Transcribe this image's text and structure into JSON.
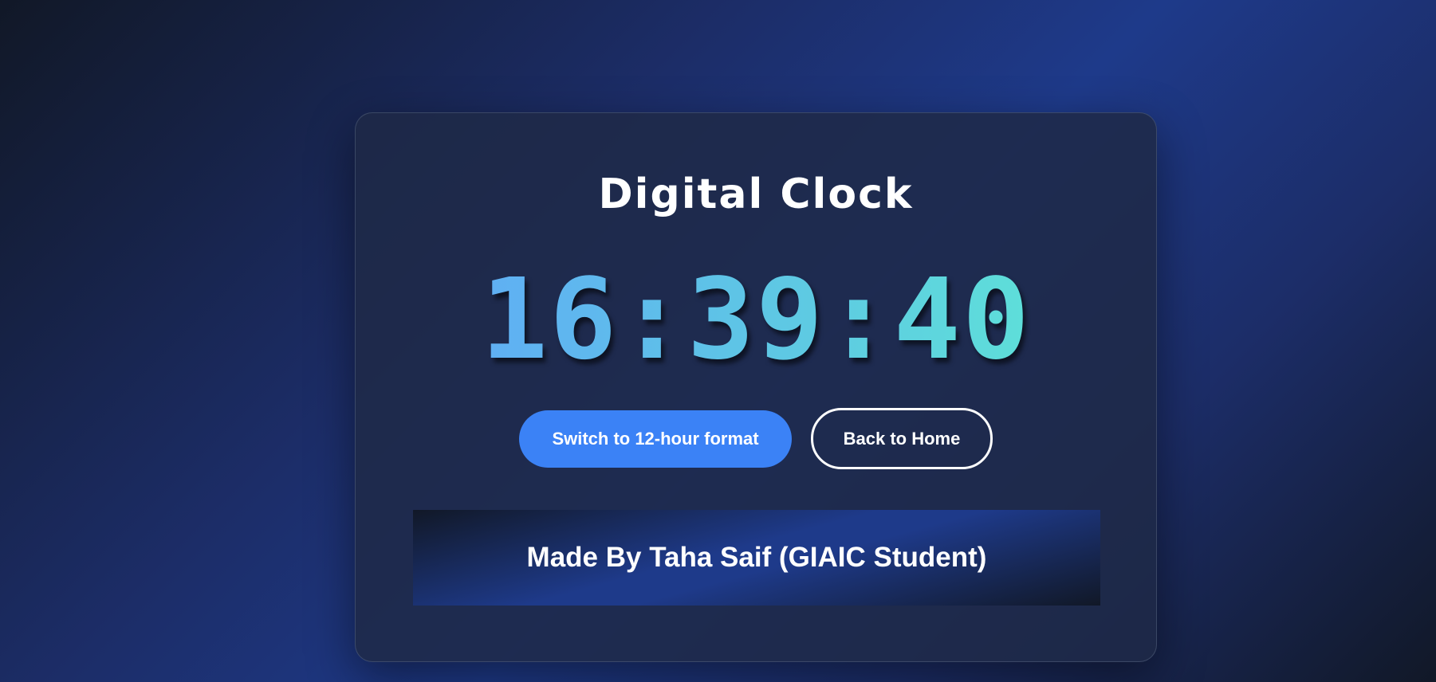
{
  "card": {
    "title": "Digital Clock",
    "time": "16:39:40",
    "buttons": {
      "format_toggle": "Switch to 12-hour format",
      "home": "Back to Home"
    },
    "footer": "Made By Taha Saif (GIAIC Student)"
  },
  "colors": {
    "background_dark": "#111827",
    "background_accent": "#1e3a8a",
    "card_bg": "#1f2946",
    "primary_button": "#3b82f6",
    "clock_gradient_start": "#60a5fa",
    "clock_gradient_end": "#5eead4",
    "text": "#ffffff"
  }
}
